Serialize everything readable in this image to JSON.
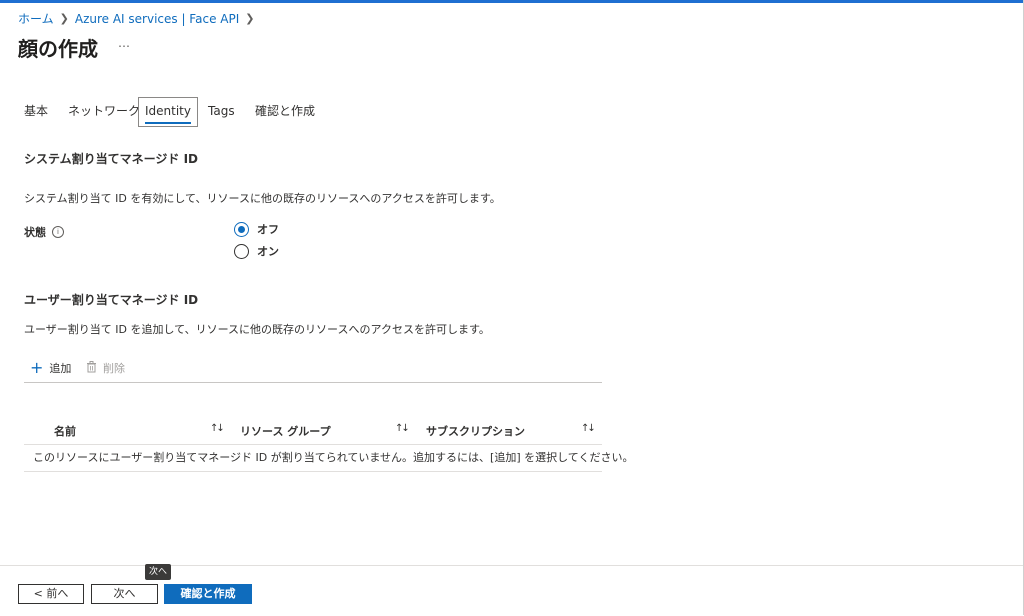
{
  "breadcrumb": {
    "items": [
      "ホーム",
      "Azure AI services | Face API"
    ]
  },
  "page": {
    "title": "顔の作成",
    "more": "…"
  },
  "tabs": [
    {
      "label": "基本",
      "active": false
    },
    {
      "label": "ネットワーク",
      "active": false
    },
    {
      "label": "Identity",
      "active": true
    },
    {
      "label": "Tags",
      "active": false
    },
    {
      "label": "確認と作成",
      "active": false
    }
  ],
  "system_identity": {
    "title": "システム割り当てマネージド ID",
    "description": "システム割り当て ID を有効にして、リソースに他の既存のリソースへのアクセスを許可します。",
    "state_label": "状態",
    "options": [
      {
        "label": "オフ",
        "checked": true
      },
      {
        "label": "オン",
        "checked": false
      }
    ]
  },
  "user_identity": {
    "title": "ユーザー割り当てマネージド ID",
    "description": "ユーザー割り当て ID を追加して、リソースに他の既存のリソースへのアクセスを許可します。",
    "add_label": "追加",
    "delete_label": "削除",
    "columns": [
      "名前",
      "リソース グループ",
      "サブスクリプション"
    ],
    "sort_glyph": "↑↓",
    "empty_message": "このリソースにユーザー割り当てマネージド ID が割り当てられていません。追加するには、[追加] を選択してください。"
  },
  "footer": {
    "prev_label": "< 前へ",
    "next_label": "次へ",
    "create_label": "確認と作成",
    "tooltip": "次へ"
  },
  "colors": {
    "accent": "#0f6cbd"
  }
}
